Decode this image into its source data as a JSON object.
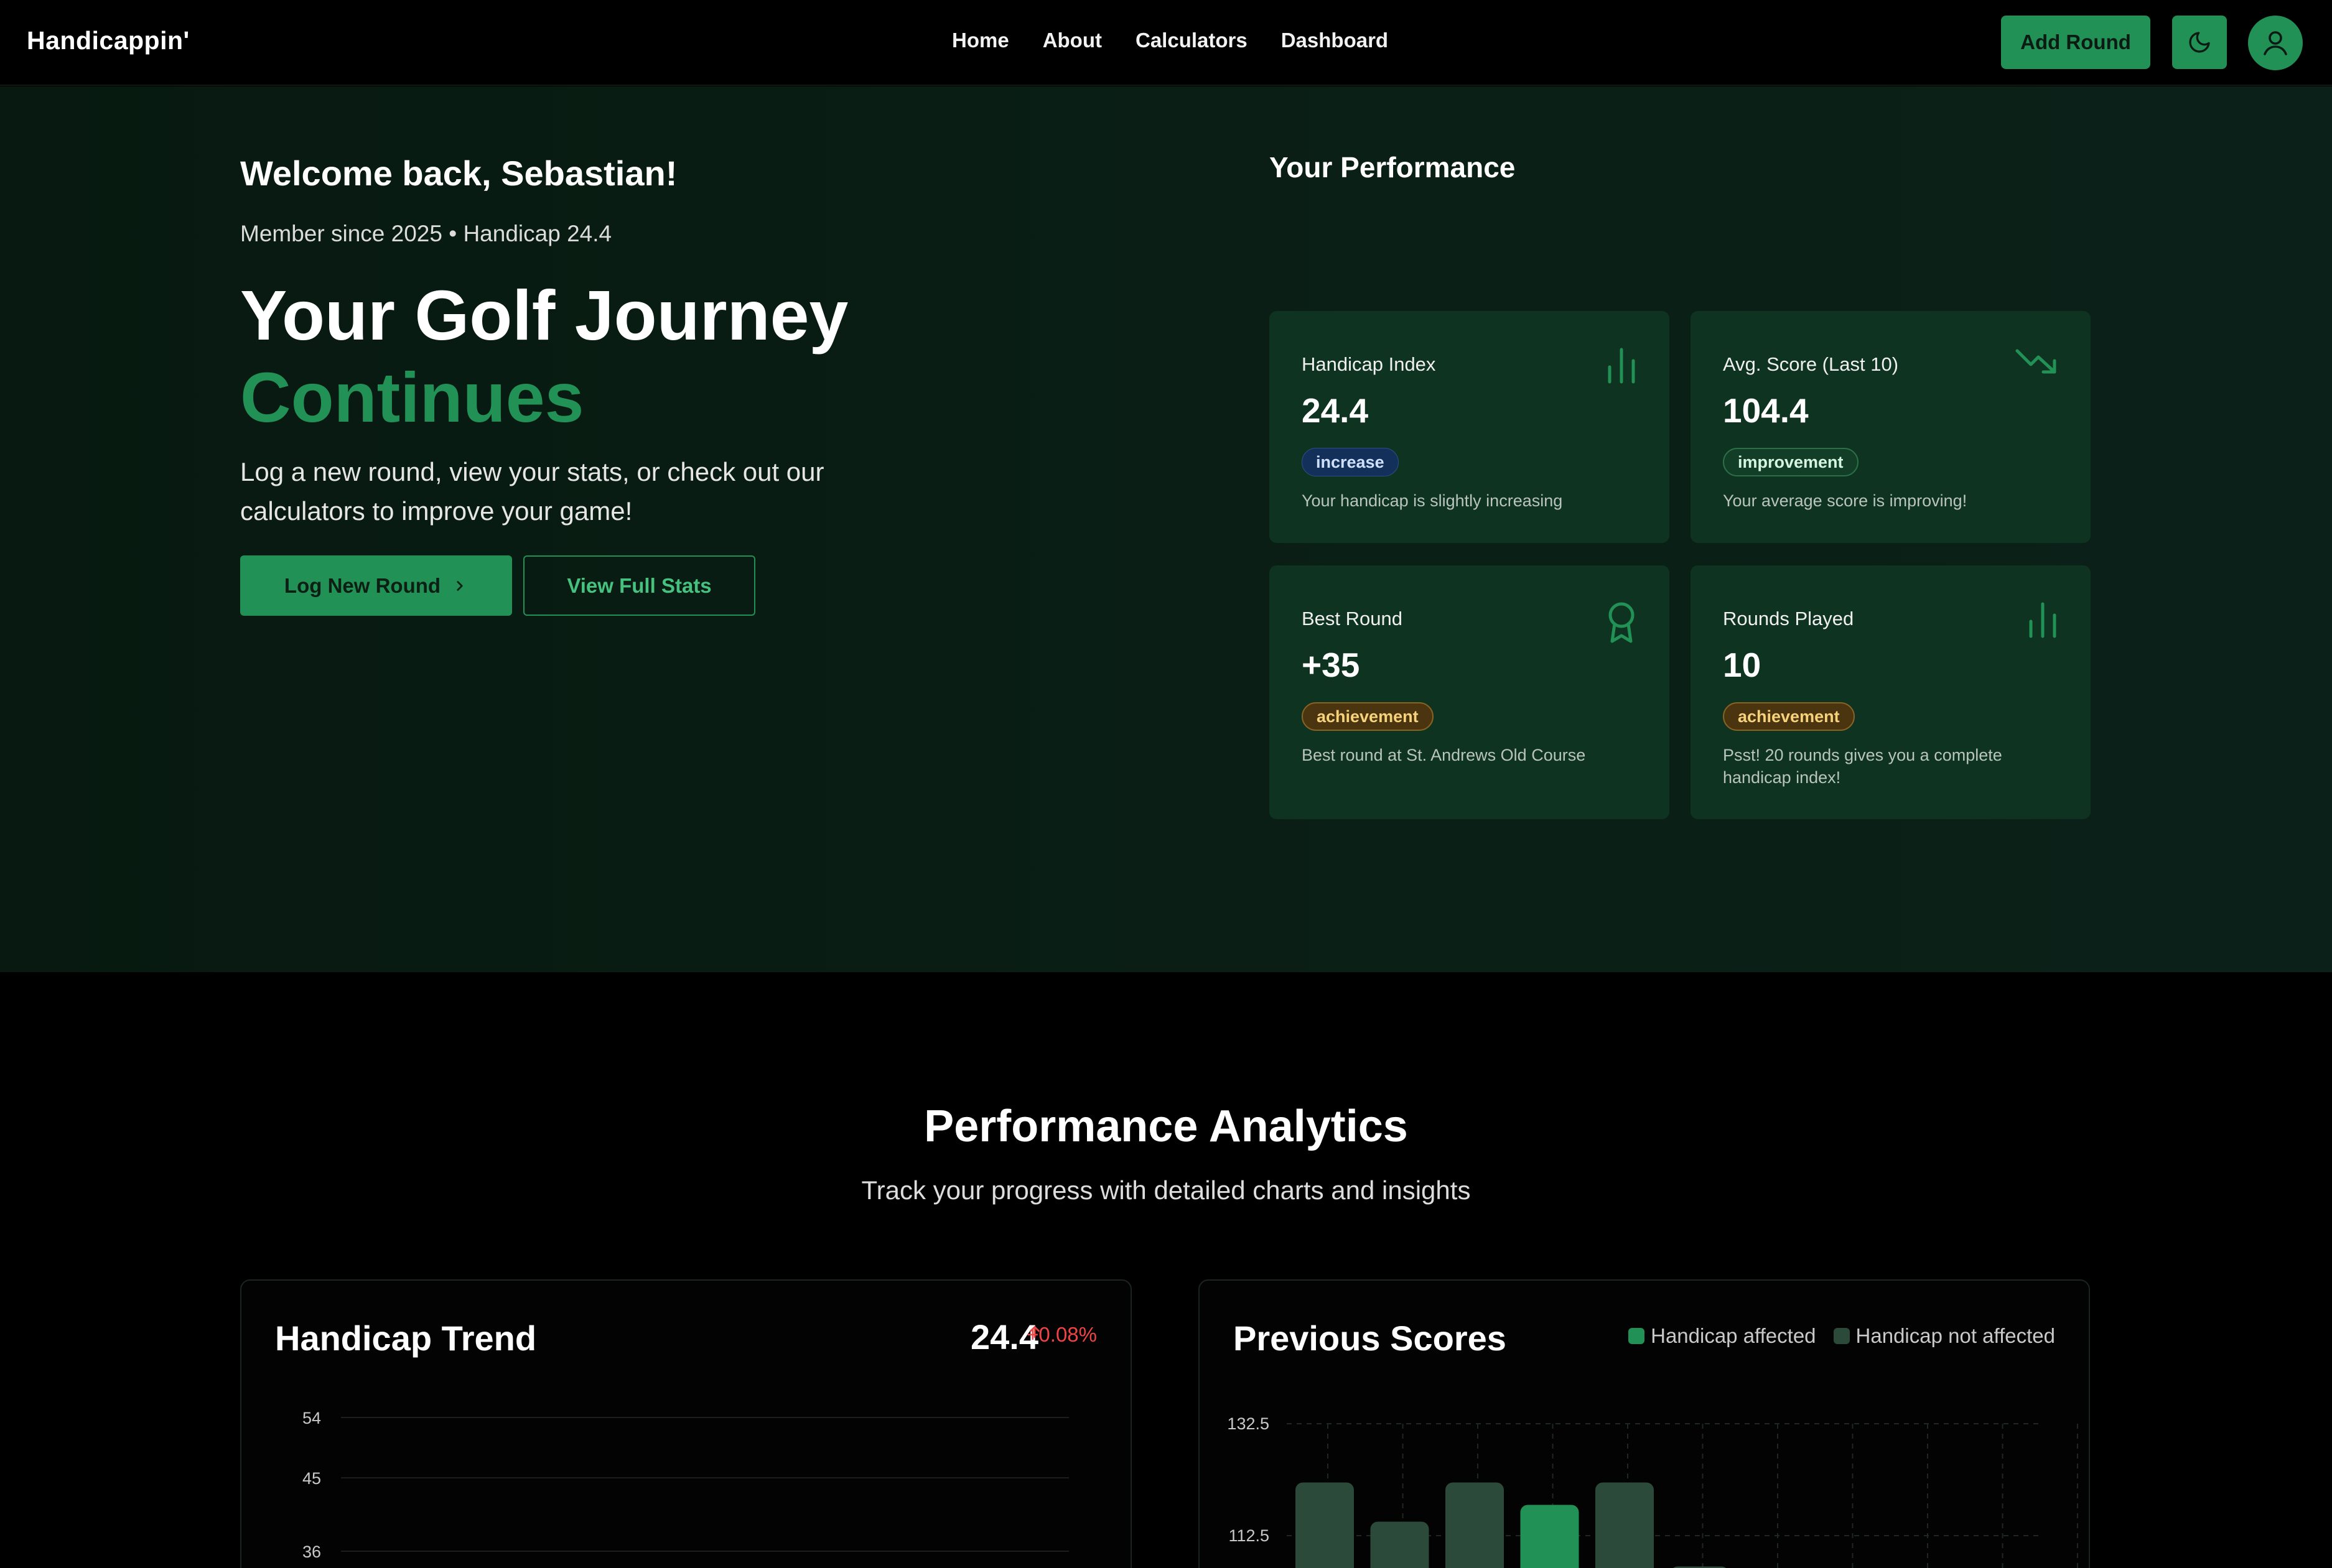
{
  "nav": {
    "brand": "Handicappin'",
    "links": [
      "Home",
      "About",
      "Calculators",
      "Dashboard"
    ],
    "add_round": "Add Round"
  },
  "hero": {
    "welcome": "Welcome back, Sebastian!",
    "member": "Member since 2025 • Handicap 24.4",
    "headline_1": "Your Golf Journey",
    "headline_2": "Continues",
    "description": "Log a new round, view your stats, or check out our calculators to improve your game!",
    "btn_log": "Log New Round",
    "btn_stats": "View Full Stats"
  },
  "performance": {
    "title": "Your Performance",
    "cards": [
      {
        "title": "Handicap Index",
        "value": "24.4",
        "badge": "increase",
        "note": "Your handicap is slightly increasing",
        "icon": "bar-chart-icon"
      },
      {
        "title": "Avg. Score (Last 10)",
        "value": "104.4",
        "badge": "improvement",
        "note": "Your average score is improving!",
        "icon": "trending-down-icon"
      },
      {
        "title": "Best Round",
        "value": "+35",
        "badge": "achievement",
        "note": "Best round at St. Andrews Old Course",
        "icon": "award-icon"
      },
      {
        "title": "Rounds Played",
        "value": "10",
        "badge": "achievement",
        "note": "Psst! 20 rounds gives you a complete handicap index!",
        "icon": "bar-chart-icon"
      }
    ]
  },
  "analytics": {
    "title": "Performance Analytics",
    "subtitle": "Track your progress with detailed charts and insights"
  },
  "colors": {
    "accent": "#229155",
    "bar_affected": "#229155",
    "bar_not_affected": "#2c4a3a",
    "delta_red": "#ef4444"
  },
  "chart_data": [
    {
      "type": "line",
      "title": "Handicap Trend",
      "headline_value": "24.4",
      "delta": "+0.08%",
      "y_ticks": [
        "54",
        "45",
        "36"
      ]
    },
    {
      "type": "bar",
      "title": "Previous Scores",
      "legend": [
        "Handicap affected",
        "Handicap not affected"
      ],
      "y_ticks": [
        "132.5",
        "112.5"
      ],
      "series": [
        {
          "name": "Handicap affected",
          "values": [
            null,
            null,
            null,
            118,
            null,
            null
          ]
        },
        {
          "name": "Handicap not affected",
          "values": [
            122,
            115,
            122,
            null,
            122,
            107
          ]
        }
      ]
    }
  ]
}
